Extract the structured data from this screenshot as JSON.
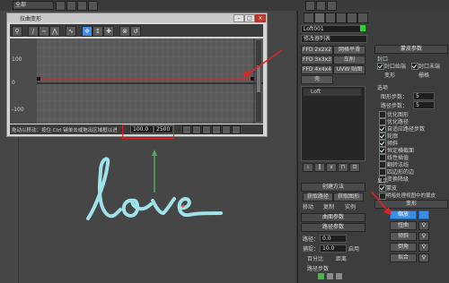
{
  "topbar": {
    "dropdown": "全部"
  },
  "graph": {
    "title": "拉曲变形",
    "y_ticks": [
      "100",
      "0",
      "-100"
    ],
    "status_text": "拖动以移动：按住 Ctrl 键单击或拖出区域框以进",
    "field_a": "100.0",
    "field_b": "2500"
  },
  "panel": {
    "object_name": "Loft001",
    "modifier_list": "修改器列表",
    "mod_buttons": [
      "FFD 2x2x2",
      "网格平滑",
      "FFD 3x3x3",
      "车削",
      "FFD 4x4x4",
      "UVW 贴图",
      "壳"
    ],
    "stack_item": "Loft",
    "roll_creation": "创建方法",
    "get_path": "获取路径",
    "get_shape": "获取图形",
    "move": "移动",
    "copy": "复制",
    "instance": "实例",
    "roll_surface": "曲面参数",
    "roll_path": "路径参数",
    "path_label": "路径：",
    "path_value": "0.0",
    "snap_label": "捕捉：",
    "snap_value": "10.0",
    "enable": "启用",
    "percent": "百分比",
    "distance": "距离",
    "path_steps": "路径步数",
    "roll_skin": "蒙皮参数",
    "capping": "封口",
    "cap_start": "封口始端",
    "cap_end": "封口末端",
    "morph": "变形",
    "grid": "栅格",
    "options": "选项",
    "shape_steps_label": "图形步数：",
    "shape_steps": "5",
    "path_steps_label": "路径步数：",
    "path_steps_val": "5",
    "opt_items": [
      "优化图形",
      "优化路径",
      "自适应路径步数",
      "轮廓",
      "倾斜",
      "恒定横截面",
      "线性插值",
      "翻转法线",
      "四边形的边",
      "变换降级"
    ],
    "opt_checked": [
      false,
      false,
      true,
      true,
      true,
      true,
      false,
      false,
      false,
      false
    ],
    "display": "显示",
    "display_items": [
      "蒙皮",
      "明暗处理视图中的蒙皮"
    ],
    "roll_deform": "变形",
    "deform_buttons": [
      "缩放",
      "扭曲",
      "倾斜",
      "倒角",
      "拟合"
    ]
  },
  "colors": {
    "highlight": "#3d8ee6",
    "red_annotation": "#d22222",
    "curve": "#9fe2ea"
  }
}
